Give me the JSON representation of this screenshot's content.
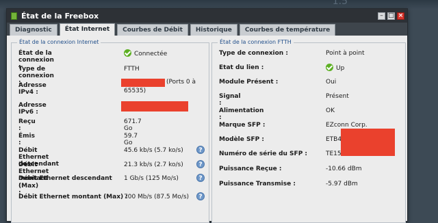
{
  "window": {
    "title": "État de la Freebox",
    "background_label": "1.5"
  },
  "tabs": [
    {
      "label": "Diagnostic",
      "active": false
    },
    {
      "label": "État Internet",
      "active": true
    },
    {
      "label": "Courbes de Débit",
      "active": false
    },
    {
      "label": "Historique",
      "active": false
    },
    {
      "label": "Courbes de température",
      "active": false
    }
  ],
  "internet": {
    "legend": "État de la connexion Internet",
    "rows": [
      {
        "label": "État de la connexion :",
        "value": "Connectée",
        "icon": "check-icon"
      },
      {
        "label": "Type de connexion :",
        "value": "FTTH"
      },
      {
        "label": "Adresse IPv4 :",
        "value": "(Ports 0 à",
        "value2": "65535)"
      },
      {
        "label": "Adresse IPv6 :",
        "value": "."
      },
      {
        "label": "Reçu :",
        "value": "671.7 Go"
      },
      {
        "label": "Émis :",
        "value": "59.7 Go"
      },
      {
        "label": "Débit Ethernet descendant :",
        "value": "45.6 kb/s (5.7 ko/s)",
        "help": true
      },
      {
        "label": "Débit Ethernet montant :",
        "value": "21.3 kb/s (2.7 ko/s)",
        "help": true
      },
      {
        "label": "Débit Ethernet descendant",
        "label2": "(Max) :",
        "value": "1 Gb/s (125 Mo/s)",
        "help": true
      },
      {
        "label": "Débit Ethernet montant (Max) :",
        "value": "700 Mb/s (87.5 Mo/s)",
        "help": true
      }
    ]
  },
  "ftth": {
    "legend": "État de la connexion FTTH",
    "rows": [
      {
        "label": "Type de connexion :",
        "value": "Point à point"
      },
      {
        "label": "Etat du lien :",
        "value": "Up",
        "icon": "check-icon"
      },
      {
        "label": "Module Présent :",
        "value": "Oui"
      },
      {
        "label": "Signal :",
        "value": "Présent"
      },
      {
        "label": "Alimentation :",
        "value": "OK"
      },
      {
        "label": "Marque SFP :",
        "value": "EZconn Corp."
      },
      {
        "label": "Modèle SFP :",
        "value": "ETB43"
      },
      {
        "label": "Numéro de série du SFP :",
        "value": "TE152"
      },
      {
        "label": "Puissance Reçue :",
        "value": "-10.66 dBm"
      },
      {
        "label": "Puissance Transmise :",
        "value": "-5.97 dBm"
      }
    ]
  },
  "colors": {
    "accent_green": "#5db023",
    "help_blue": "#6f98c9",
    "redaction": "#ea412d",
    "legend_text": "#214f8a"
  }
}
